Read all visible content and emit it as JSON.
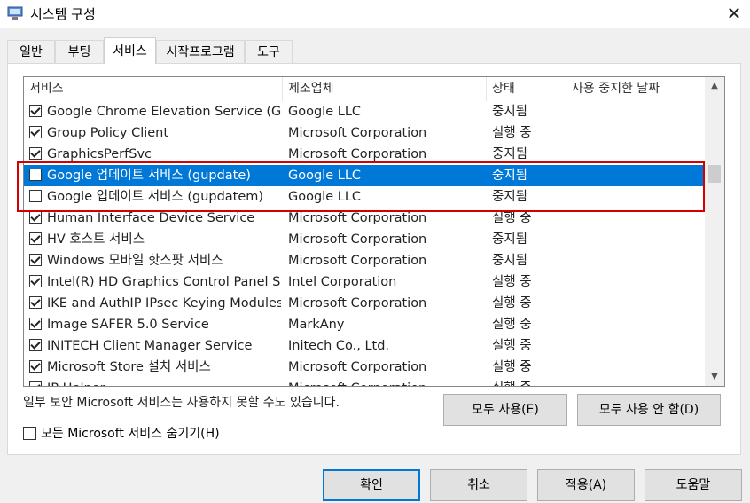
{
  "window": {
    "title": "시스템 구성",
    "close_glyph": "✕"
  },
  "tabs": [
    "일반",
    "부팅",
    "서비스",
    "시작프로그램",
    "도구"
  ],
  "active_tab": "서비스",
  "columns": [
    "서비스",
    "제조업체",
    "상태",
    "사용 중지한 날짜"
  ],
  "services": [
    {
      "name": "Google Chrome Elevation Service (G...",
      "manufacturer": "Google LLC",
      "status": "중지됨",
      "checked": true,
      "selected": false
    },
    {
      "name": "Group Policy Client",
      "manufacturer": "Microsoft Corporation",
      "status": "실행 중",
      "checked": true,
      "selected": false
    },
    {
      "name": "GraphicsPerfSvc",
      "manufacturer": "Microsoft Corporation",
      "status": "중지됨",
      "checked": true,
      "selected": false
    },
    {
      "name": "Google 업데이트 서비스 (gupdate)",
      "manufacturer": "Google LLC",
      "status": "중지됨",
      "checked": false,
      "selected": true
    },
    {
      "name": "Google 업데이트 서비스 (gupdatem)",
      "manufacturer": "Google LLC",
      "status": "중지됨",
      "checked": false,
      "selected": false
    },
    {
      "name": "Human Interface Device Service",
      "manufacturer": "Microsoft Corporation",
      "status": "실행 중",
      "checked": true,
      "selected": false
    },
    {
      "name": "HV 호스트 서비스",
      "manufacturer": "Microsoft Corporation",
      "status": "중지됨",
      "checked": true,
      "selected": false
    },
    {
      "name": "Windows 모바일 핫스팟 서비스",
      "manufacturer": "Microsoft Corporation",
      "status": "중지됨",
      "checked": true,
      "selected": false
    },
    {
      "name": "Intel(R) HD Graphics Control Panel S...",
      "manufacturer": "Intel Corporation",
      "status": "실행 중",
      "checked": true,
      "selected": false
    },
    {
      "name": "IKE and AuthIP IPsec Keying Modules",
      "manufacturer": "Microsoft Corporation",
      "status": "실행 중",
      "checked": true,
      "selected": false
    },
    {
      "name": "Image SAFER 5.0 Service",
      "manufacturer": "MarkAny",
      "status": "실행 중",
      "checked": true,
      "selected": false
    },
    {
      "name": "INITECH Client Manager Service",
      "manufacturer": "Initech Co., Ltd.",
      "status": "실행 중",
      "checked": true,
      "selected": false
    },
    {
      "name": "Microsoft Store 설치 서비스",
      "manufacturer": "Microsoft Corporation",
      "status": "실행 중",
      "checked": true,
      "selected": false
    },
    {
      "name": "IP Helper",
      "manufacturer": "Microsoft Corporation",
      "status": "실행 중",
      "checked": true,
      "selected": false
    }
  ],
  "note": "일부 보안 Microsoft 서비스는 사용하지 못할 수도 있습니다.",
  "enable_all": "모두 사용(E)",
  "disable_all": "모두 사용 안 함(D)",
  "hide_ms_label": "모든 Microsoft 서비스 숨기기(H)",
  "buttons": {
    "ok": "확인",
    "cancel": "취소",
    "apply": "적용(A)",
    "help": "도움말"
  },
  "scroll": {
    "up": "▲",
    "down": "▼"
  },
  "colors": {
    "selection": "#0078d7",
    "highlight_box": "#d40000"
  }
}
